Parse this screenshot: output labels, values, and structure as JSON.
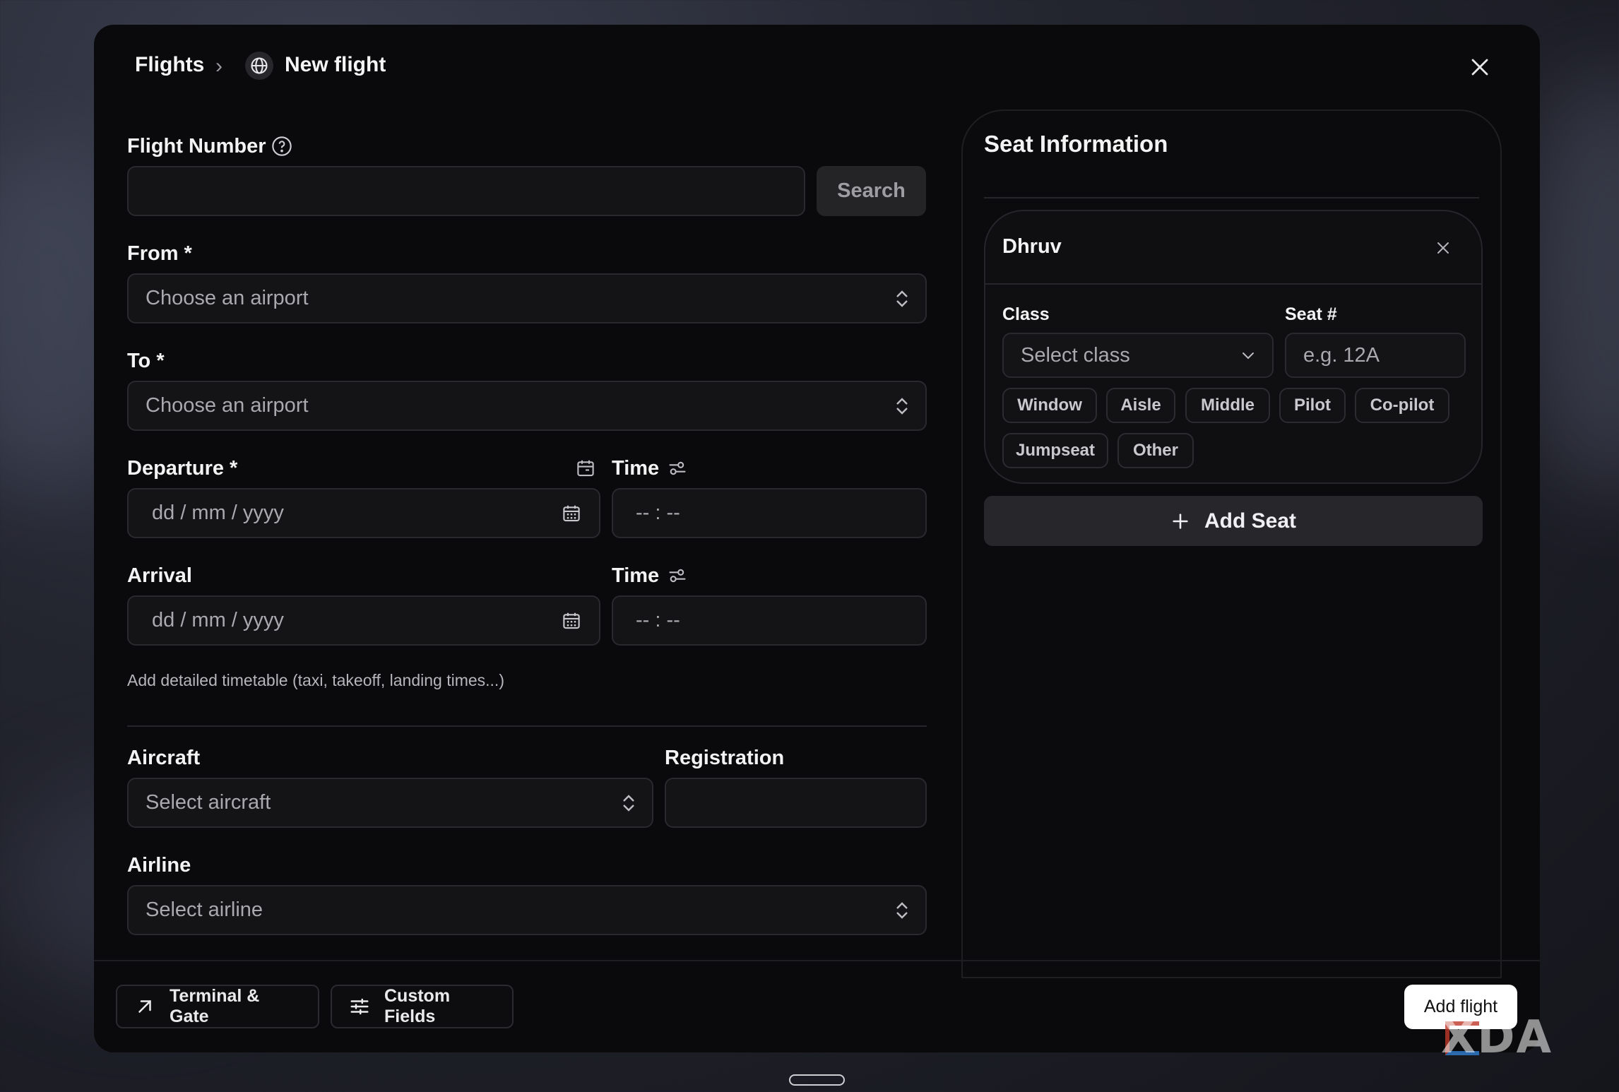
{
  "breadcrumb": {
    "root": "Flights",
    "separator": "›",
    "current": "New flight"
  },
  "form": {
    "flight_number": {
      "label": "Flight Number",
      "value": "",
      "search_label": "Search"
    },
    "from": {
      "label": "From *",
      "placeholder": "Choose an airport"
    },
    "to": {
      "label": "To *",
      "placeholder": "Choose an airport"
    },
    "departure": {
      "label": "Departure *",
      "date_placeholder": "dd / mm / yyyy",
      "time_label": "Time",
      "time_placeholder": "-- : --"
    },
    "arrival": {
      "label": "Arrival",
      "date_placeholder": "dd / mm / yyyy",
      "time_label": "Time",
      "time_placeholder": "-- : --"
    },
    "timetable_link": "Add detailed timetable (taxi, takeoff, landing times...)",
    "aircraft": {
      "label": "Aircraft",
      "placeholder": "Select aircraft"
    },
    "registration": {
      "label": "Registration",
      "value": ""
    },
    "airline": {
      "label": "Airline",
      "placeholder": "Select airline"
    }
  },
  "seat_info": {
    "title": "Seat Information",
    "passenger": "Dhruv",
    "class_label": "Class",
    "class_placeholder": "Select class",
    "seat_label": "Seat #",
    "seat_placeholder": "e.g. 12A",
    "seat_types": [
      "Window",
      "Aisle",
      "Middle",
      "Pilot",
      "Co-pilot",
      "Jumpseat",
      "Other"
    ],
    "add_seat": "Add Seat"
  },
  "footer": {
    "terminal_gate": "Terminal & Gate",
    "custom_fields": "Custom Fields",
    "submit": "Add flight"
  },
  "watermark": "XDA",
  "icons": [
    "globe-icon",
    "close-icon",
    "help-icon",
    "chevron-updown-icon",
    "calendar-icon",
    "sliders-icon",
    "chevron-down-icon",
    "plus-icon",
    "arrow-up-right-icon",
    "settings-sliders-icon"
  ]
}
